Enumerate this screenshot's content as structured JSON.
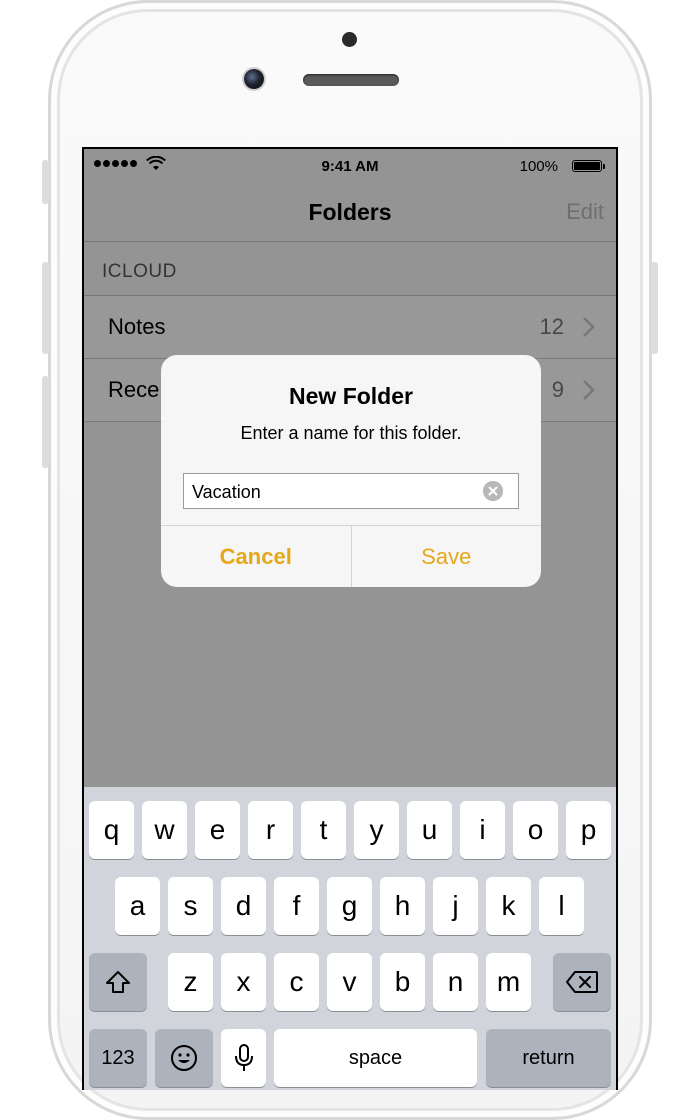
{
  "status_bar": {
    "time": "9:41 AM",
    "battery": "100%"
  },
  "nav": {
    "title": "Folders",
    "edit_label": "Edit"
  },
  "section": {
    "header": "ICLOUD"
  },
  "folders": [
    {
      "label": "Notes",
      "count": "12"
    },
    {
      "label": "Rece",
      "count": "9"
    }
  ],
  "alert": {
    "title": "New Folder",
    "message": "Enter a name for this folder.",
    "input_value": "Vacation",
    "cancel_label": "Cancel",
    "save_label": "Save",
    "accent_color": "#E4A81A"
  },
  "keyboard": {
    "row1": [
      "q",
      "w",
      "e",
      "r",
      "t",
      "y",
      "u",
      "i",
      "o",
      "p"
    ],
    "row2": [
      "a",
      "s",
      "d",
      "f",
      "g",
      "h",
      "j",
      "k",
      "l"
    ],
    "row3": [
      "z",
      "x",
      "c",
      "v",
      "b",
      "n",
      "m"
    ],
    "numbers_label": "123",
    "space_label": "space",
    "return_label": "return",
    "shift_icon": "shift-icon",
    "delete_icon": "backspace-icon",
    "emoji_icon": "emoji-icon",
    "mic_icon": "microphone-icon"
  }
}
